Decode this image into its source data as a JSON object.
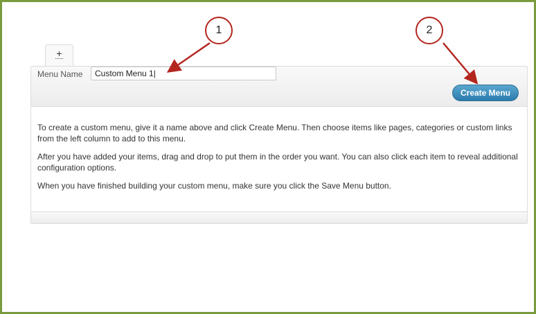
{
  "tab": {
    "plus_label": "+"
  },
  "form": {
    "menu_name_label": "Menu Name",
    "menu_name_value": "Custom Menu 1|",
    "create_button_label": "Create Menu"
  },
  "instructions": [
    "To create a custom menu, give it a name above and click Create Menu. Then choose items like pages, categories or custom links from the left column to add to this menu.",
    "After you have added your items, drag and drop to put them in the order you want. You can also click each item to reveal additional configuration options.",
    "When you have finished building your custom menu, make sure you click the Save Menu button."
  ],
  "callouts": [
    {
      "label": "1"
    },
    {
      "label": "2"
    }
  ],
  "colors": {
    "frame": "#7a9a3e",
    "callout": "#b3261e",
    "button": "#2b7cae"
  }
}
